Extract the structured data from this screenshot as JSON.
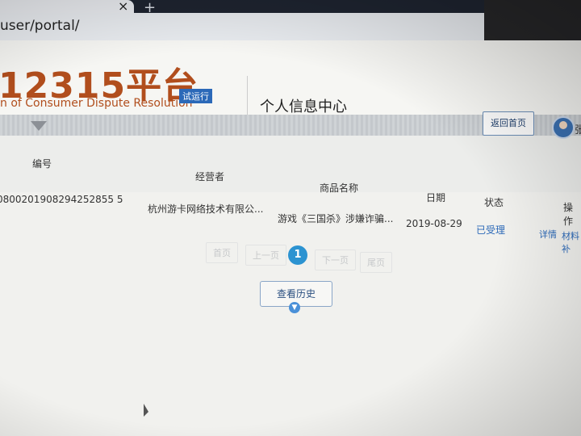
{
  "browser": {
    "tab_close": "×",
    "new_tab": "+",
    "url": "user/portal/"
  },
  "header": {
    "logo_text": "12315平台",
    "logo_subtitle": "n of Consumer Dispute Resolution",
    "trial_badge": "试运行",
    "page_title": "个人信息中心",
    "back_button": "返回首页",
    "username": "张"
  },
  "table": {
    "columns": {
      "id": "编号",
      "operator": "经营者",
      "product": "商品名称",
      "date": "日期",
      "status": "状态",
      "actions": "操作"
    },
    "rows": [
      {
        "id": "0800201908294252855 5",
        "operator": "杭州游卡网络技术有限公...",
        "product": "游戏《三国杀》涉嫌诈骗...",
        "date": "2019-08-29",
        "status": "已受理",
        "action_detail": "详情",
        "action_materials": "材料补"
      }
    ]
  },
  "pagination": {
    "first": "首页",
    "prev": "上一页",
    "current": "1",
    "next": "下一页",
    "last": "尾页"
  },
  "history_button": "查看历史",
  "colors": {
    "brand": "#b14e1d",
    "accent": "#2c93d1",
    "link": "#2b69b8"
  }
}
